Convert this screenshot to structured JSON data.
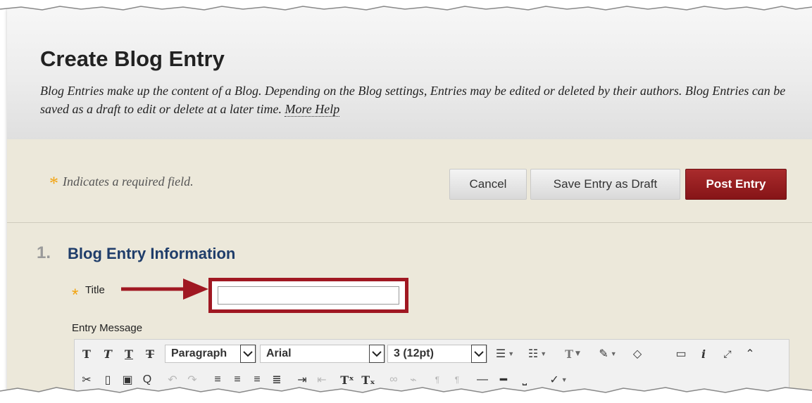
{
  "header": {
    "title": "Create Blog Entry",
    "description": "Blog Entries make up the content of a Blog. Depending on the Blog settings, Entries may be edited or deleted by their authors. Blog Entries can be saved as a draft to edit or delete at a later time.",
    "more_help": "More Help"
  },
  "actions": {
    "required_star": "*",
    "required_note": "Indicates a required field.",
    "cancel_label": "Cancel",
    "draft_label": "Save Entry as Draft",
    "post_label": "Post Entry"
  },
  "section": {
    "number": "1.",
    "title": "Blog Entry Information"
  },
  "fields": {
    "title_star": "*",
    "title_label": "Title",
    "title_value": "",
    "entry_label": "Entry Message"
  },
  "toolbar": {
    "format_value": "Paragraph",
    "font_value": "Arial",
    "size_value": "3 (12pt)"
  },
  "colors": {
    "accent_red": "#a01822",
    "post_button": "#96191c",
    "section_title": "#1f3d6a",
    "required_star": "#f2a30f",
    "content_bg": "#ece8da"
  }
}
